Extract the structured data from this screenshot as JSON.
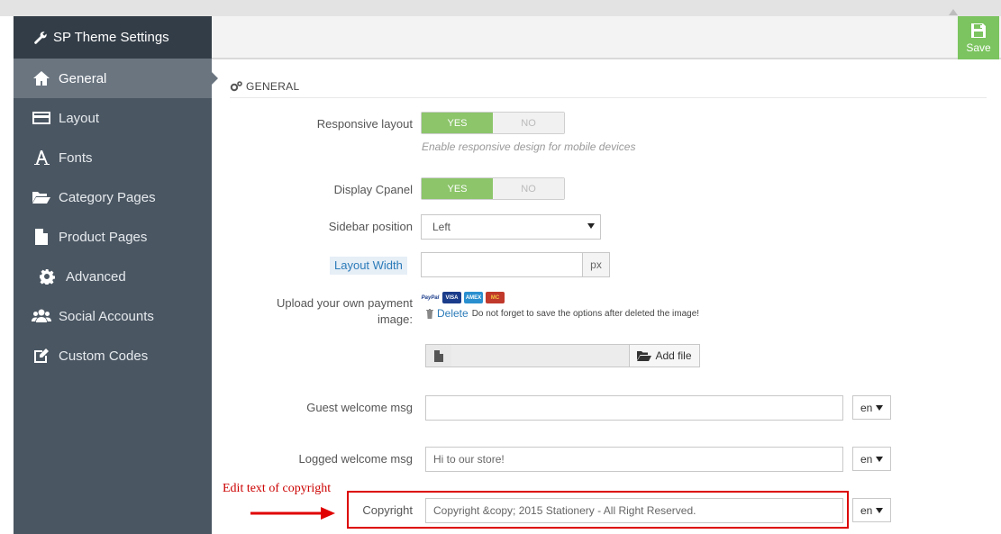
{
  "sidebar": {
    "title": "SP Theme Settings",
    "items": [
      {
        "label": "General",
        "icon": "home-icon",
        "active": true
      },
      {
        "label": "Layout",
        "icon": "layout-card-icon"
      },
      {
        "label": "Fonts",
        "icon": "font-a-icon"
      },
      {
        "label": "Category Pages",
        "icon": "folder-open-icon"
      },
      {
        "label": "Product Pages",
        "icon": "file-text-icon"
      },
      {
        "label": "Advanced",
        "icon": "gear-icon"
      },
      {
        "label": "Social Accounts",
        "icon": "users-icon"
      },
      {
        "label": "Custom Codes",
        "icon": "edit-icon"
      }
    ]
  },
  "toolbar": {
    "save_label": "Save"
  },
  "section": {
    "title": "GENERAL"
  },
  "form": {
    "responsive": {
      "label": "Responsive layout",
      "yes": "YES",
      "no": "NO",
      "help": "Enable responsive design for mobile devices"
    },
    "cpanel": {
      "label": "Display Cpanel",
      "yes": "YES",
      "no": "NO"
    },
    "sidebar_position": {
      "label": "Sidebar position",
      "value": "Left"
    },
    "layout_width": {
      "label": "Layout Width",
      "value": "",
      "unit": "px"
    },
    "payment": {
      "label_line1": "Upload your own payment",
      "label_line2": "image:",
      "cards": [
        "PayPal",
        "VISA",
        "AMEX",
        "MC"
      ],
      "delete_label": "Delete",
      "delete_note": "Do not forget to save the options after deleted the image!",
      "add_file_label": "Add file"
    },
    "guest_welcome": {
      "label": "Guest welcome msg",
      "value": "",
      "lang": "en"
    },
    "logged_welcome": {
      "label": "Logged welcome msg",
      "value": "Hi to our store!",
      "lang": "en"
    },
    "copyright": {
      "label": "Copyright",
      "value": "Copyright &copy; 2015 Stationery - All Right Reserved.",
      "lang": "en"
    }
  },
  "annotation": {
    "text": "Edit text of copyright",
    "color": "#cc0000"
  },
  "colors": {
    "sidebar": "#4a5662",
    "sidebar_title": "#333d47",
    "accent_green": "#7bc45f",
    "link_blue": "#2b7bb9"
  }
}
